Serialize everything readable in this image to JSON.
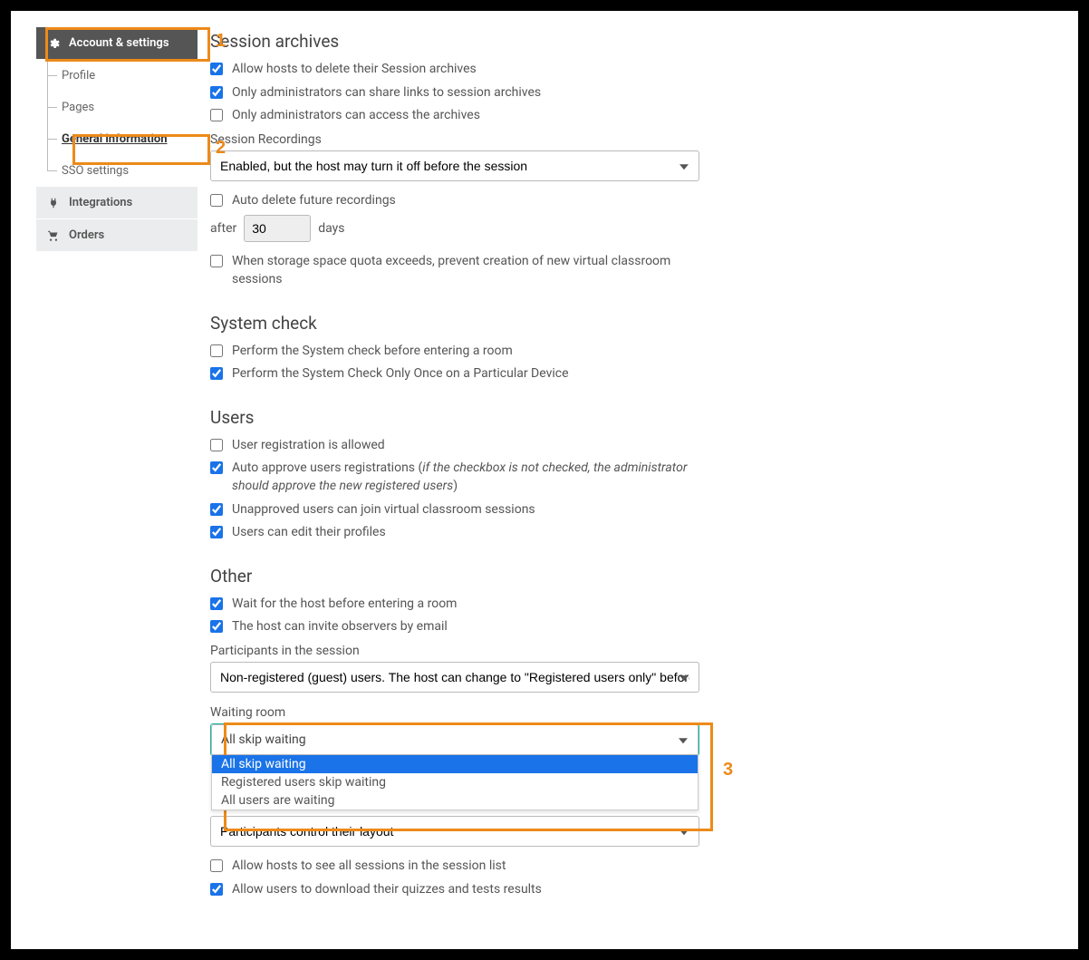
{
  "sidebar": {
    "account": {
      "label": "Account & settings"
    },
    "sub": [
      {
        "label": "Profile"
      },
      {
        "label": "Pages"
      },
      {
        "label": "General information"
      },
      {
        "label": "SSO settings"
      }
    ],
    "integrations": {
      "label": "Integrations"
    },
    "orders": {
      "label": "Orders"
    }
  },
  "annotations": {
    "n1": "1",
    "n2": "2",
    "n3": "3"
  },
  "sections": {
    "archives": {
      "title": "Session archives",
      "cb1": "Allow hosts to delete their Session archives",
      "cb2": "Only administrators can share links to session archives",
      "cb3": "Only administrators can access the archives",
      "recordings_label": "Session Recordings",
      "recordings_value": "Enabled, but the host may turn it off before the session",
      "auto_delete": "Auto delete future recordings",
      "after": "after",
      "days_value": "30",
      "days": "days",
      "quota": "When storage space quota exceeds, prevent creation of new virtual classroom sessions"
    },
    "system": {
      "title": "System check",
      "cb1": "Perform the System check before entering a room",
      "cb2": "Perform the System Check Only Once on a Particular Device"
    },
    "users": {
      "title": "Users",
      "cb1": "User registration is allowed",
      "cb2_pre": "Auto approve users registrations (",
      "cb2_italic": "if the checkbox is not checked, the administrator should approve the new registered users",
      "cb2_post": ")",
      "cb3": "Unapproved users can join virtual classroom sessions",
      "cb4": "Users can edit their profiles"
    },
    "other": {
      "title": "Other",
      "cb1": "Wait for the host before entering a room",
      "cb2": "The host can invite observers by email",
      "participants_label": "Participants in the session",
      "participants_value": "Non-registered (guest) users. The host can change to \"Registered users only\" before the session",
      "waiting_label": "Waiting room",
      "waiting_value": "All skip waiting",
      "waiting_options": [
        "All skip waiting",
        "Registered users skip waiting",
        "All users are waiting"
      ],
      "layout_value": "Participants control their layout",
      "cb3": "Allow hosts to see all sessions in the session list",
      "cb4": "Allow users to download their quizzes and tests results"
    }
  }
}
